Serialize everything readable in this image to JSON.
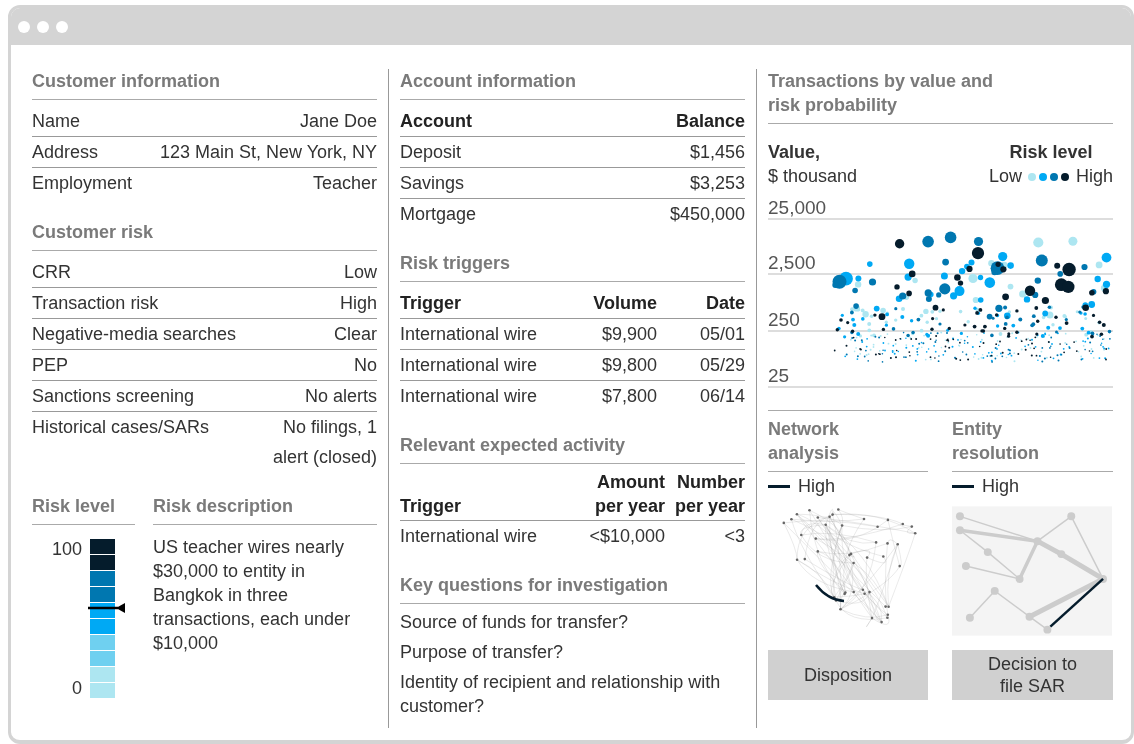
{
  "customer_information": {
    "title": "Customer information",
    "rows": [
      {
        "label": "Name",
        "value": "Jane Doe"
      },
      {
        "label": "Address",
        "value": "123 Main St, New York, NY"
      },
      {
        "label": "Employment",
        "value": "Teacher"
      }
    ]
  },
  "customer_risk": {
    "title": "Customer risk",
    "rows": [
      {
        "label": "CRR",
        "value": "Low"
      },
      {
        "label": "Transaction risk",
        "value": "High"
      },
      {
        "label": "Negative-media searches",
        "value": "Clear"
      },
      {
        "label": "PEP",
        "value": "No"
      },
      {
        "label": "Sanctions screening",
        "value": "No alerts"
      },
      {
        "label": "Historical cases/SARs",
        "value": "No filings, 1 alert (closed)"
      }
    ]
  },
  "risk_level": {
    "title": "Risk level",
    "max_label": "100",
    "min_label": "0",
    "level": 0.57,
    "segments": [
      {
        "color": "#051c2c"
      },
      {
        "color": "#051c2c"
      },
      {
        "color": "#0077b0"
      },
      {
        "color": "#0077b0"
      },
      {
        "color": "#00a9f4"
      },
      {
        "color": "#00a9f4"
      },
      {
        "color": "#6fd0f0"
      },
      {
        "color": "#6fd0f0"
      },
      {
        "color": "#ade6f1"
      },
      {
        "color": "#ade6f1"
      }
    ]
  },
  "risk_description": {
    "title": "Risk description",
    "text": "US teacher wires nearly $30,000 to entity in Bangkok in three transactions, each under $10,000"
  },
  "account_information": {
    "title": "Account information",
    "columns": [
      "Account",
      "Balance"
    ],
    "rows": [
      [
        "Deposit",
        "$1,456"
      ],
      [
        "Savings",
        "$3,253"
      ],
      [
        "Mortgage",
        "$450,000"
      ]
    ]
  },
  "risk_triggers": {
    "title": "Risk triggers",
    "columns": [
      "Trigger",
      "Volume",
      "Date"
    ],
    "rows": [
      [
        "International wire",
        "$9,900",
        "05/01"
      ],
      [
        "International wire",
        "$9,800",
        "05/29"
      ],
      [
        "International wire",
        "$7,800",
        "06/14"
      ]
    ]
  },
  "expected_activity": {
    "title": "Relevant expected activity",
    "columns": [
      "Trigger",
      "Amount per year",
      "Number per year"
    ],
    "rows": [
      [
        "International wire",
        "<$10,000",
        "<3"
      ]
    ]
  },
  "key_questions": {
    "title": "Key questions for investigation",
    "items": [
      "Source of funds for transfer?",
      "Purpose of transfer?",
      "Identity of recipient and relationship with customer?"
    ]
  },
  "transactions": {
    "title": "Transactions by value and risk probability",
    "value_label": "Value,",
    "unit_label": "$ thousand",
    "legend": {
      "title": "Risk level",
      "low": "Low",
      "high": "High",
      "levels": [
        {
          "color": "#ade6f1"
        },
        {
          "color": "#00a9f4"
        },
        {
          "color": "#0077b0"
        },
        {
          "color": "#051c2c"
        }
      ]
    },
    "yticks": [
      "25,000",
      "2,500",
      "250",
      "25"
    ]
  },
  "network_analysis": {
    "title": "Network analysis",
    "legend": "High"
  },
  "entity_resolution": {
    "title": "Entity resolution",
    "legend": "High"
  },
  "buttons": [
    "Disposition",
    "Decision to file SAR"
  ]
}
